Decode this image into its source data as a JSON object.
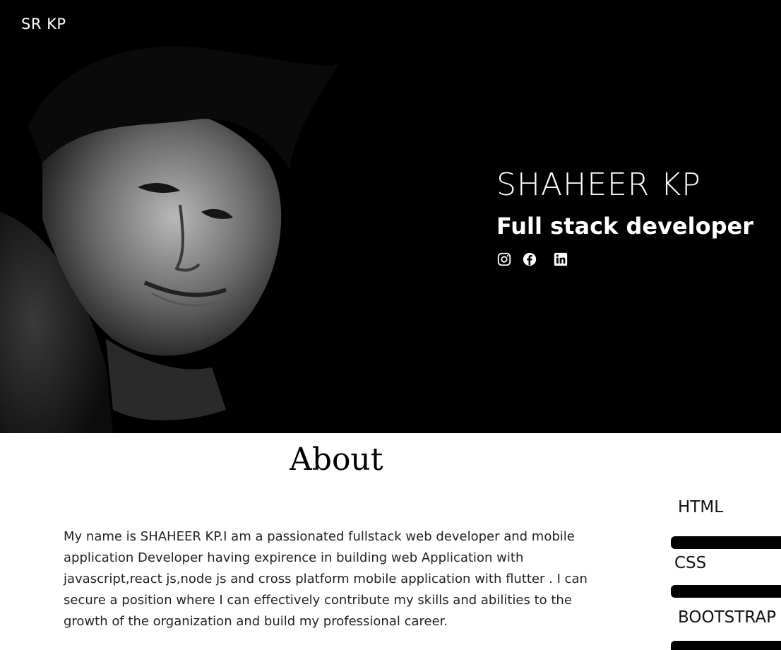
{
  "brand": "SR KP",
  "hero": {
    "name": "SHAHEER KP",
    "role": "Full stack developer",
    "socials": [
      {
        "icon": "instagram-icon"
      },
      {
        "icon": "facebook-icon"
      },
      {
        "icon": "linkedin-icon"
      }
    ]
  },
  "about": {
    "title": "About",
    "text": "My name is SHAHEER KP.I am a passionated fullstack web developer and mobile application Developer having expirence in building web Application with javascript,react js,node js and cross platform mobile application with flutter . I can secure a position where I can effectively contribute my skills and abilities to the growth of the organization and build my professional career."
  },
  "skills": [
    {
      "label": "HTML"
    },
    {
      "label": "CSS"
    },
    {
      "label": "BOOTSTRAP"
    }
  ],
  "colors": {
    "hero_bg": "#000000",
    "text_light": "#ffffff",
    "bar": "#000000"
  }
}
